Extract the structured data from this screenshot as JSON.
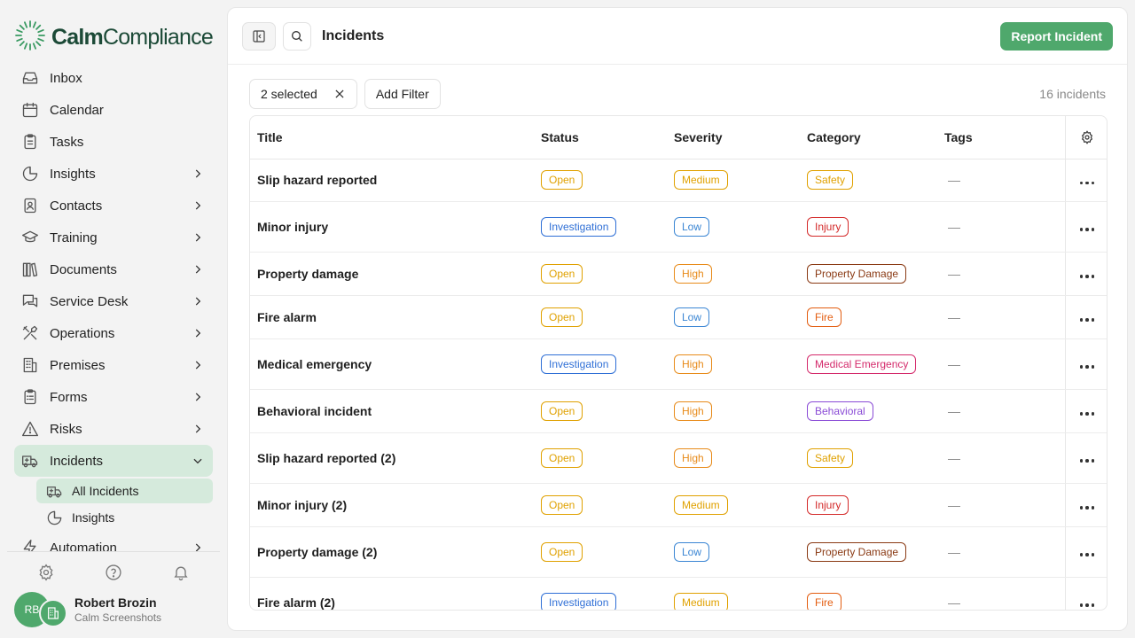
{
  "brand": {
    "name_bold": "Calm",
    "name_rest": "Compliance",
    "accent": "#4fa86c"
  },
  "sidebar": {
    "items": [
      {
        "label": "Inbox",
        "icon": "inbox-icon",
        "chevron": false
      },
      {
        "label": "Calendar",
        "icon": "calendar-icon",
        "chevron": false
      },
      {
        "label": "Tasks",
        "icon": "clipboard-icon",
        "chevron": false
      },
      {
        "label": "Insights",
        "icon": "pie-chart-icon",
        "chevron": true
      },
      {
        "label": "Contacts",
        "icon": "contact-book-icon",
        "chevron": true
      },
      {
        "label": "Training",
        "icon": "graduation-cap-icon",
        "chevron": true
      },
      {
        "label": "Documents",
        "icon": "library-icon",
        "chevron": true
      },
      {
        "label": "Service Desk",
        "icon": "messages-icon",
        "chevron": true
      },
      {
        "label": "Operations",
        "icon": "tools-icon",
        "chevron": true
      },
      {
        "label": "Premises",
        "icon": "building-icon",
        "chevron": true
      },
      {
        "label": "Forms",
        "icon": "clipboard-list-icon",
        "chevron": true
      },
      {
        "label": "Risks",
        "icon": "warning-triangle-icon",
        "chevron": true
      }
    ],
    "active_item": {
      "label": "Incidents",
      "icon": "ambulance-icon"
    },
    "sub_items": [
      {
        "label": "All Incidents",
        "icon": "ambulance-icon",
        "active": true
      },
      {
        "label": "Insights",
        "icon": "pie-chart-icon",
        "active": false
      }
    ],
    "after_item": {
      "label": "Automation",
      "icon": "zap-icon"
    }
  },
  "user": {
    "initials": "RB",
    "name": "Robert Brozin",
    "org": "Calm Screenshots"
  },
  "header": {
    "title": "Incidents",
    "report_button": "Report Incident"
  },
  "filters": {
    "selected_label": "2 selected",
    "add_filter": "Add Filter",
    "count": "16 incidents"
  },
  "table": {
    "columns": {
      "title": "Title",
      "status": "Status",
      "severity": "Severity",
      "category": "Category",
      "tags": "Tags"
    },
    "rows": [
      {
        "title": "Slip hazard reported",
        "status": "Open",
        "severity": "Medium",
        "category": "Safety",
        "tags": "—"
      },
      {
        "title": "Minor injury",
        "status": "Investigation",
        "severity": "Low",
        "category": "Injury",
        "tags": "—"
      },
      {
        "title": "Property damage",
        "status": "Open",
        "severity": "High",
        "category": "Property Damage",
        "tags": "—"
      },
      {
        "title": "Fire alarm",
        "status": "Open",
        "severity": "Low",
        "category": "Fire",
        "tags": "—"
      },
      {
        "title": "Medical emergency",
        "status": "Investigation",
        "severity": "High",
        "category": "Medical Emergency",
        "tags": "—"
      },
      {
        "title": "Behavioral incident",
        "status": "Open",
        "severity": "High",
        "category": "Behavioral",
        "tags": "—"
      },
      {
        "title": "Slip hazard reported (2)",
        "status": "Open",
        "severity": "High",
        "category": "Safety",
        "tags": "—"
      },
      {
        "title": "Minor injury (2)",
        "status": "Open",
        "severity": "Medium",
        "category": "Injury",
        "tags": "—"
      },
      {
        "title": "Property damage (2)",
        "status": "Open",
        "severity": "Low",
        "category": "Property Damage",
        "tags": "—"
      },
      {
        "title": "Fire alarm (2)",
        "status": "Investigation",
        "severity": "Medium",
        "category": "Fire",
        "tags": "—"
      }
    ]
  },
  "colors": {
    "Open": "#e0a100",
    "Investigation": "#2f6fd6",
    "Medium": "#e0a100",
    "Low": "#3b86d4",
    "High": "#e88b1a",
    "Safety": "#e0a100",
    "Injury": "#d42a2a",
    "Property Damage": "#8a3a14",
    "Fire": "#e35d10",
    "Medical Emergency": "#d42a6b",
    "Behavioral": "#8a4bd6"
  }
}
